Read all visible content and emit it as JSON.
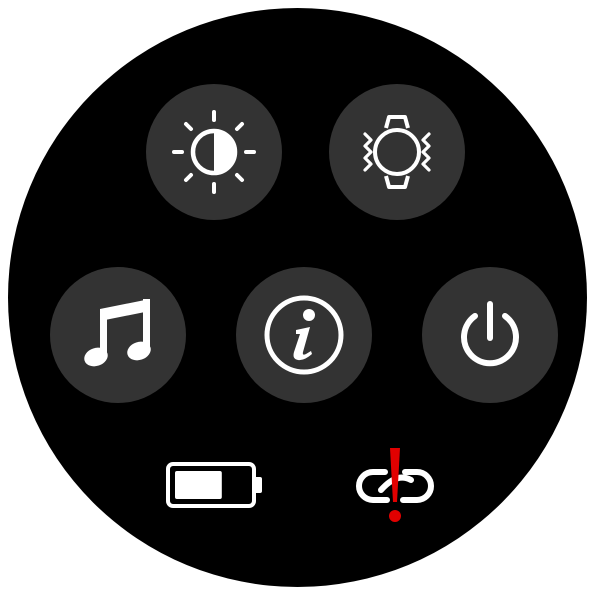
{
  "screen": "quick-settings",
  "colors": {
    "face_background": "#000000",
    "button_background": "#333333",
    "icon_color": "#ffffff",
    "alert_color": "#e10000"
  },
  "quick_actions": [
    {
      "name": "brightness",
      "icon": "brightness-icon"
    },
    {
      "name": "vibration",
      "icon": "vibrate-watch-icon"
    },
    {
      "name": "music",
      "icon": "music-note-icon"
    },
    {
      "name": "info",
      "icon": "info-icon"
    },
    {
      "name": "power",
      "icon": "power-icon"
    }
  ],
  "status": {
    "battery": {
      "icon": "battery-icon",
      "level": 0.65
    },
    "connection": {
      "icon": "link-broken-icon",
      "state": "disconnected",
      "alert": true
    }
  }
}
